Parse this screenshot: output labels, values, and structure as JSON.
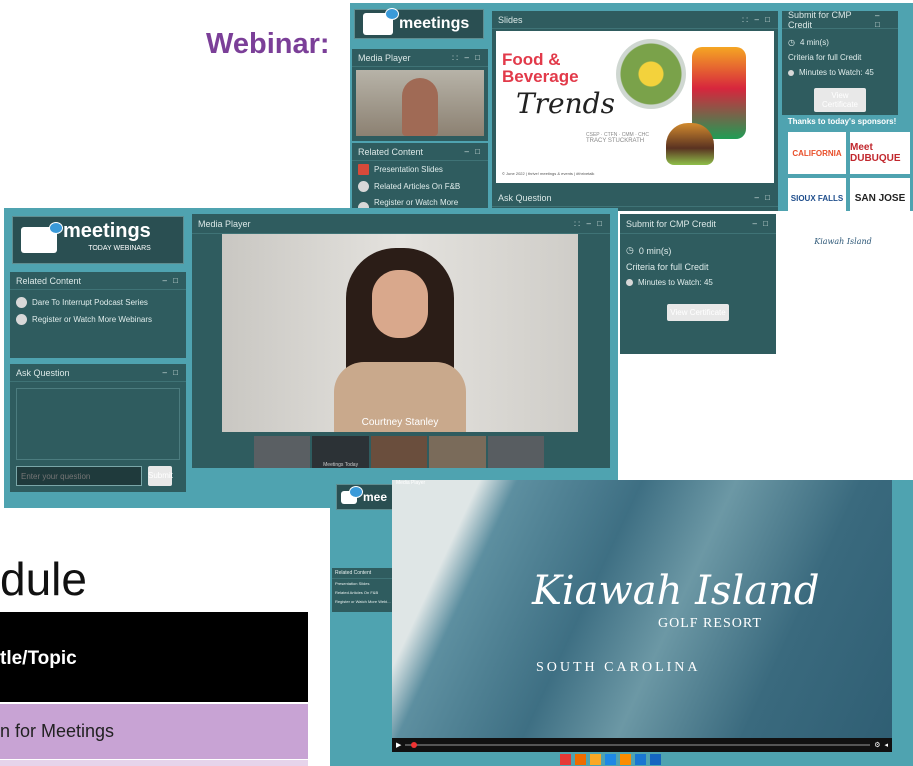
{
  "page": {
    "heading": "Webinar:",
    "schedule_heading": "dule",
    "table_header": "tle/Topic",
    "table_row_1": "n for Meetings"
  },
  "logo": {
    "word": "meetings",
    "sub": "TODAY WEBINARS",
    "short": "mee"
  },
  "top_shot": {
    "media_title": "Media Player",
    "slides_title": "Slides",
    "slide_title_line1": "Food &",
    "slide_title_line2": "Beverage",
    "slide_title_line3": "Trends",
    "slide_presenter": "TRACY STUCKRATH",
    "slide_credentials": "CSEP · CTFN · CMM · CHC",
    "slide_footer": "© June 2022 | thrive! meetings & events | #thrivetalk",
    "related_title": "Related Content",
    "related_items": [
      "Presentation Slides",
      "Related Articles On F&B",
      "Register or Watch More Webinars"
    ],
    "ask_title": "Ask Question",
    "cmp_title": "Submit for CMP Credit",
    "cmp_minutes": "4 min(s)",
    "criteria": "Criteria for full Credit",
    "minutes_to_watch": "Minutes to Watch: 45",
    "view_cert": "View Certificate",
    "thanks": "Thanks to today's sponsors!",
    "sponsors": [
      "CALIFORNIA",
      "Meet DUBUQUE",
      "SIOUX FALLS",
      "SAN JOSE",
      "Kiawah Island"
    ]
  },
  "mid_shot": {
    "media_title": "Media Player",
    "related_title": "Related Content",
    "related_items": [
      "Dare To Interrupt Podcast Series",
      "Register or Watch More Webinars"
    ],
    "ask_title": "Ask Question",
    "ask_placeholder": "Enter your question",
    "submit": "Submit",
    "speaker_name": "Courtney Stanley",
    "thumb_label": "Meetings Today",
    "cmp_title": "Submit for CMP Credit",
    "cmp_minutes": "0 min(s)",
    "criteria": "Criteria for full Credit",
    "minutes_to_watch": "Minutes to Watch: 45",
    "view_cert": "View Certificate"
  },
  "bottom_shot": {
    "media_title": "Media Player",
    "related_title": "Related Content",
    "related_items": [
      "Presentation Slides",
      "Related Articles On F&B",
      "Register or Watch More Webi..."
    ],
    "video_brand": "Kiawah Island",
    "video_sub": "GOLF RESORT",
    "video_location": "SOUTH CAROLINA"
  }
}
